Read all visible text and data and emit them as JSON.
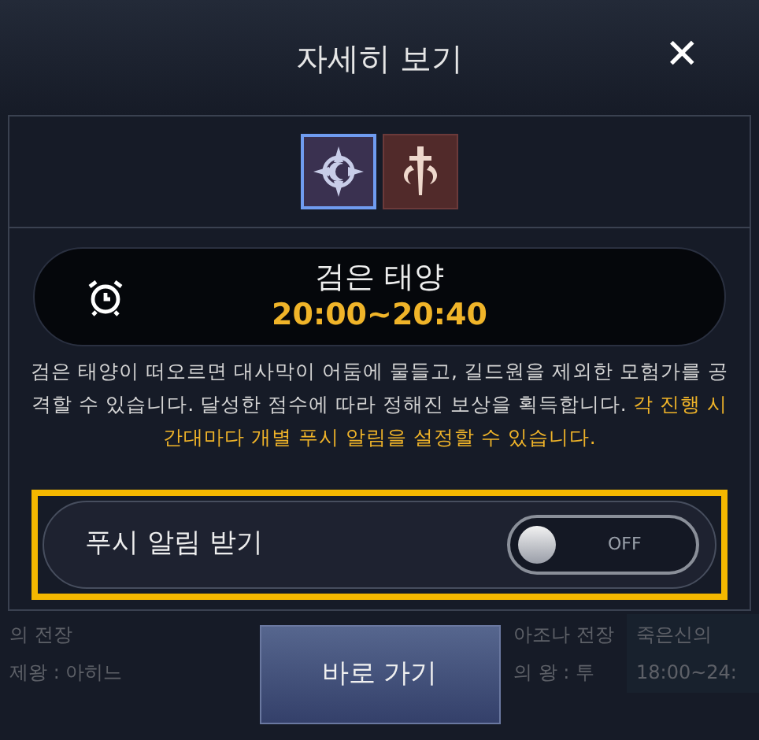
{
  "background": [
    {
      "title": "의 전장",
      "subtitle": "제왕 : 아히느"
    },
    {
      "title": "아조나 전장",
      "subtitle": "의 왕 : 투"
    },
    {
      "title": "죽은신의",
      "subtitle": "18:00~24:"
    }
  ],
  "dialog": {
    "title": "자세히 보기",
    "close": "✕",
    "modes": [
      {
        "selected": true
      },
      {
        "selected": false
      }
    ],
    "event": {
      "name": "검은 태양",
      "time": "20:00~20:40"
    },
    "description": {
      "text": "검은 태양이 떠오르면 대사막이 어둠에 물들고, 길드원을 제외한 모험가를 공격할 수 있습니다. 달성한 점수에 따라 정해진 보상을 획득합니다.",
      "highlight": "각 진행 시간대마다 개별 푸시 알림을 설정할 수 있습니다."
    },
    "push_toggle": {
      "label": "푸시 알림 받기",
      "on": false,
      "state_text": "OFF",
      "highlighted": true
    },
    "go_button": "바로 가기"
  }
}
